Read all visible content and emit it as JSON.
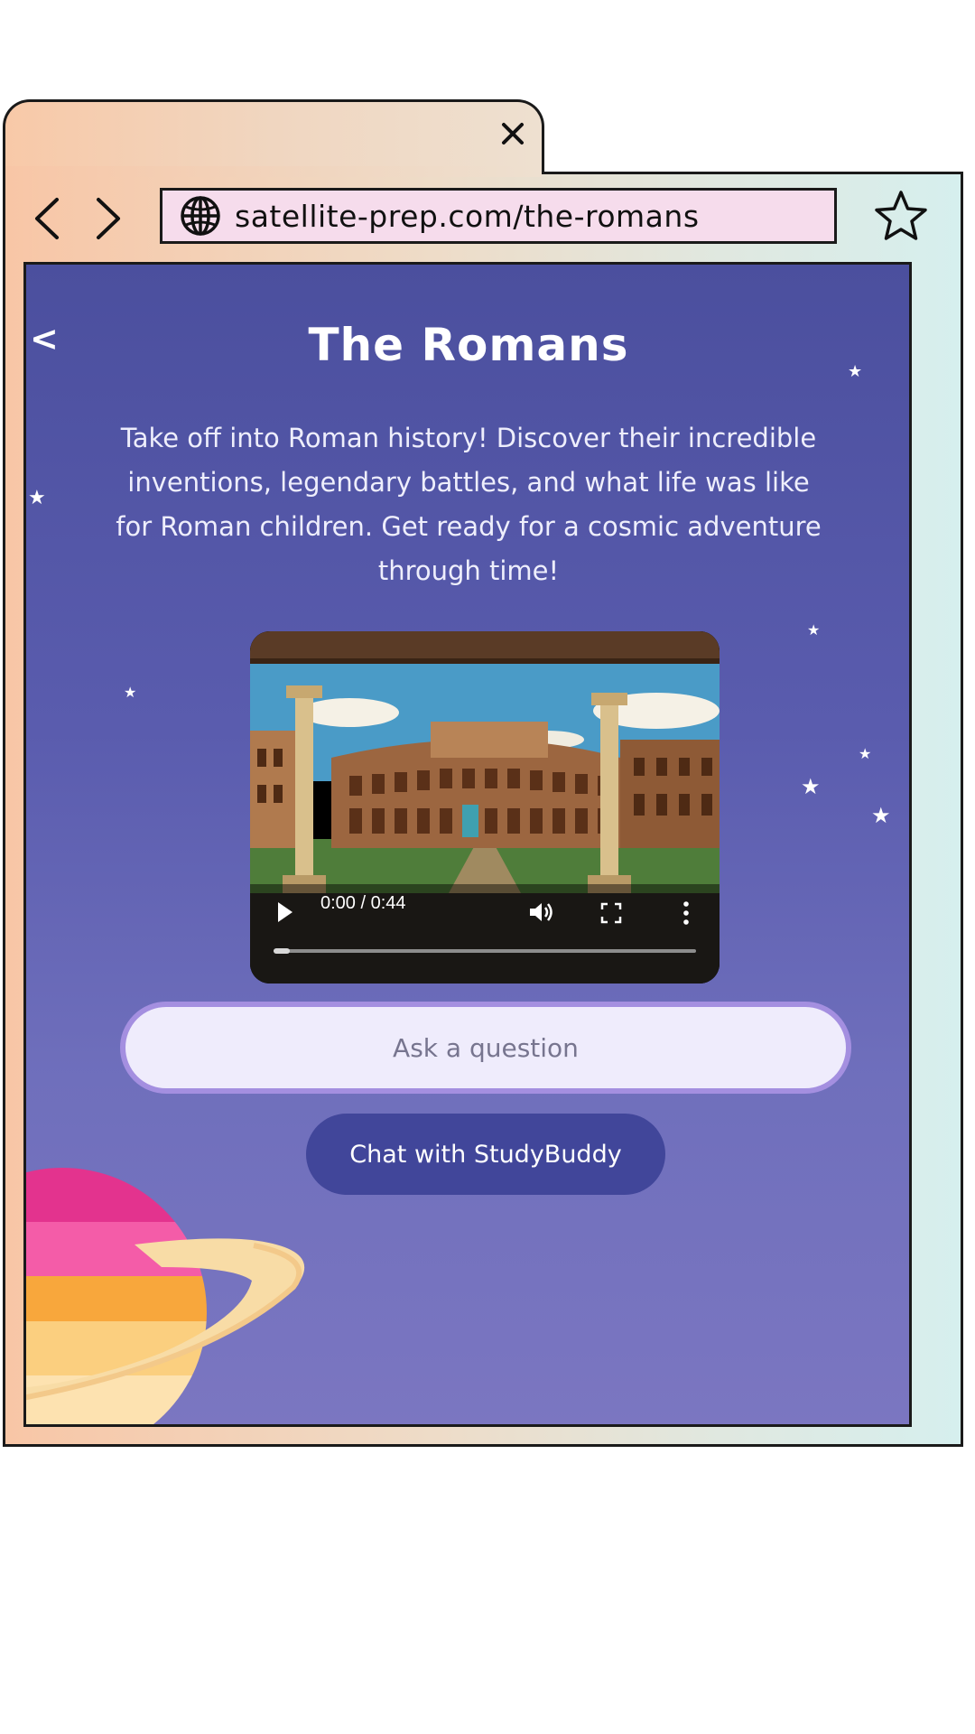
{
  "browser": {
    "tab_close_icon": "close-icon",
    "url": "satellite-prep.com/the-romans",
    "nav": {
      "back_icon": "chevron-left-icon",
      "forward_icon": "chevron-right-icon"
    },
    "bookmark_icon": "star-outline-icon"
  },
  "page": {
    "back_label": "<",
    "title": "The Romans",
    "description": "Take off into Roman history! Discover their incredible inventions, legendary battles, and what life was like for Roman children. Get ready for a cosmic adventure through time!",
    "video": {
      "time": "0:00 / 0:44",
      "progress": 0.0
    },
    "ask_placeholder": "Ask a question",
    "chat_button": "Chat with StudyBuddy"
  },
  "colors": {
    "page_top": "#4b4f9e",
    "page_bottom": "#7b76c1",
    "chat_button": "#41469a",
    "ask_border": "#a48fe0"
  }
}
